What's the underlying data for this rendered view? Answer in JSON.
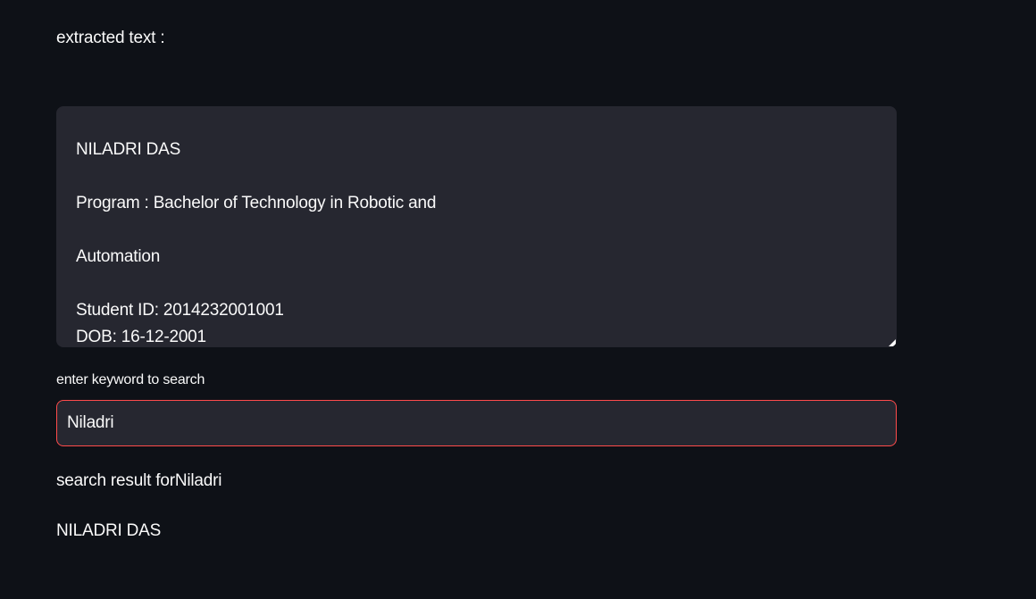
{
  "extracted": {
    "label": "extracted text :",
    "lines": [
      "NILADRI DAS",
      "",
      "Program : Bachelor of Technology in Robotic and",
      "",
      "Automation",
      "",
      "Student ID: 2014232001001",
      "DOB: 16-12-2001"
    ]
  },
  "search": {
    "label": "enter keyword to search",
    "value": "Niladri",
    "accent_color": "#ff4b4b"
  },
  "results": {
    "heading": "search result forNiladri",
    "items": [
      "NILADRI DAS"
    ]
  },
  "icons": {
    "resize": "resize-handle-icon"
  }
}
